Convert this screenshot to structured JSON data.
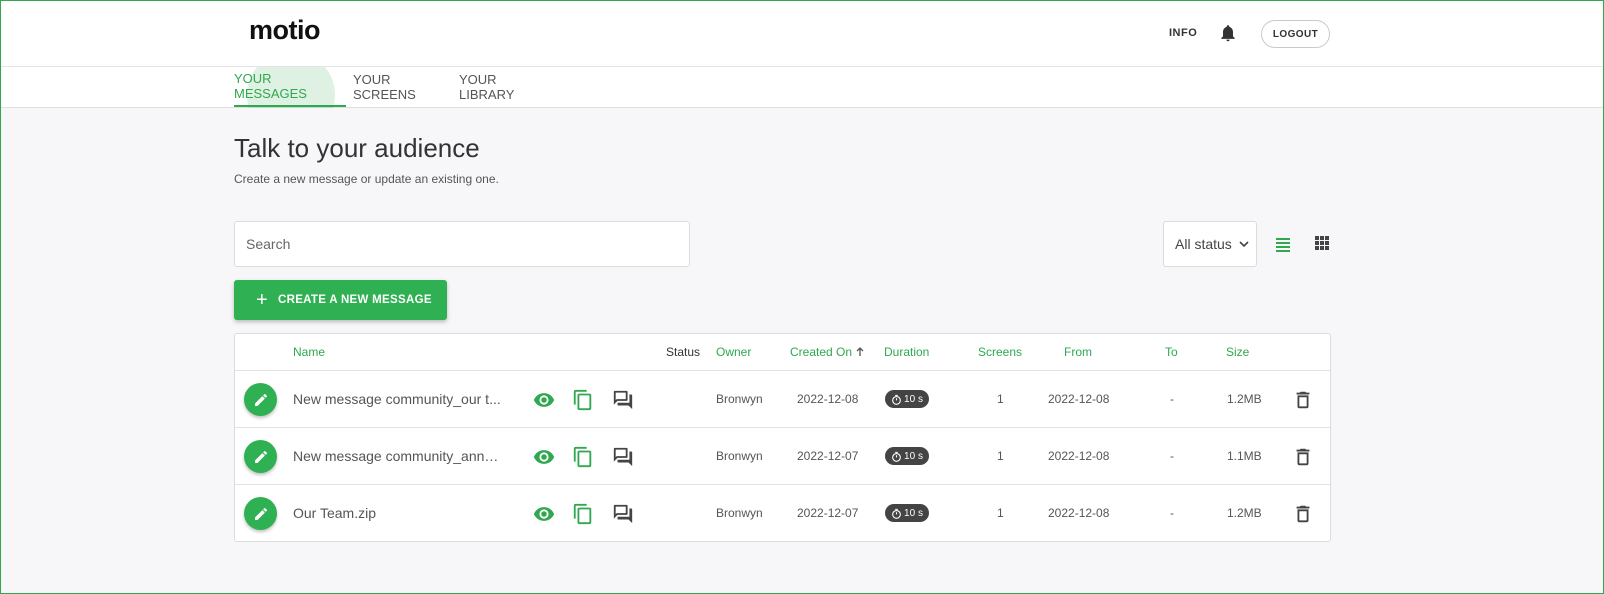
{
  "header": {
    "logo": "motio",
    "info_label": "INFO",
    "logout_label": "LOGOUT"
  },
  "tabs": [
    {
      "label": "YOUR MESSAGES",
      "active": true
    },
    {
      "label": "YOUR SCREENS",
      "active": false
    },
    {
      "label": "YOUR LIBRARY",
      "active": false
    }
  ],
  "page": {
    "title": "Talk to your audience",
    "subtitle": "Create a new message or update an existing one."
  },
  "toolbar": {
    "search_placeholder": "Search",
    "status_filter": "All status",
    "create_label": "CREATE A NEW MESSAGE"
  },
  "table": {
    "columns": {
      "name": "Name",
      "status": "Status",
      "owner": "Owner",
      "created_on": "Created On",
      "duration": "Duration",
      "screens": "Screens",
      "from": "From",
      "to": "To",
      "size": "Size"
    },
    "rows": [
      {
        "name": "New message community_our t...",
        "owner": "Bronwyn",
        "created_on": "2022-12-08",
        "duration": "10 s",
        "screens": "1",
        "from": "2022-12-08",
        "to": "-",
        "size": "1.2MB"
      },
      {
        "name": "New message community_anno...",
        "owner": "Bronwyn",
        "created_on": "2022-12-07",
        "duration": "10 s",
        "screens": "1",
        "from": "2022-12-08",
        "to": "-",
        "size": "1.1MB"
      },
      {
        "name": "Our Team.zip",
        "owner": "Bronwyn",
        "created_on": "2022-12-07",
        "duration": "10 s",
        "screens": "1",
        "from": "2022-12-08",
        "to": "-",
        "size": "1.2MB"
      }
    ]
  },
  "colors": {
    "accent": "#2fa84f",
    "button": "#2fb052",
    "badge": "#444444"
  }
}
